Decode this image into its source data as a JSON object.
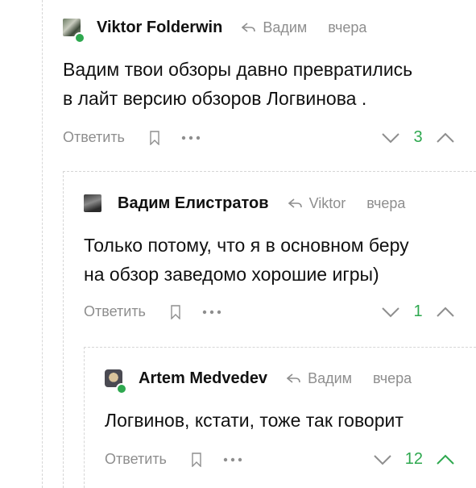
{
  "comments": [
    {
      "author": "Viktor Folderwin",
      "reply_to": "Вадим",
      "time": "вчера",
      "text_lines": [
        "Вадим твои обзоры давно превратились",
        "в лайт версию обзоров Логвинова ."
      ],
      "reply_label": "Ответить",
      "rating": "3",
      "online": true
    },
    {
      "author": "Вадим Елистратов",
      "reply_to": "Viktor",
      "time": "вчера",
      "text_lines": [
        "Только потому, что я в основном беру",
        "на обзор заведомо хорошие игры)"
      ],
      "reply_label": "Ответить",
      "rating": "1",
      "online": false
    },
    {
      "author": "Artem Medvedev",
      "reply_to": "Вадим",
      "time": "вчера",
      "text_lines": [
        "Логвинов, кстати, тоже так говорит"
      ],
      "reply_label": "Ответить",
      "rating": "12",
      "online": true
    }
  ],
  "colors": {
    "accent_green": "#2ea84f",
    "muted_gray": "#8e8e8e",
    "thread_line": "#d6d6d6"
  },
  "icons": {
    "reply": "reply-arrow-icon",
    "bookmark": "bookmark-icon",
    "more": "more-dots-icon",
    "vote_down": "chevron-down-icon",
    "vote_up": "chevron-up-icon"
  }
}
